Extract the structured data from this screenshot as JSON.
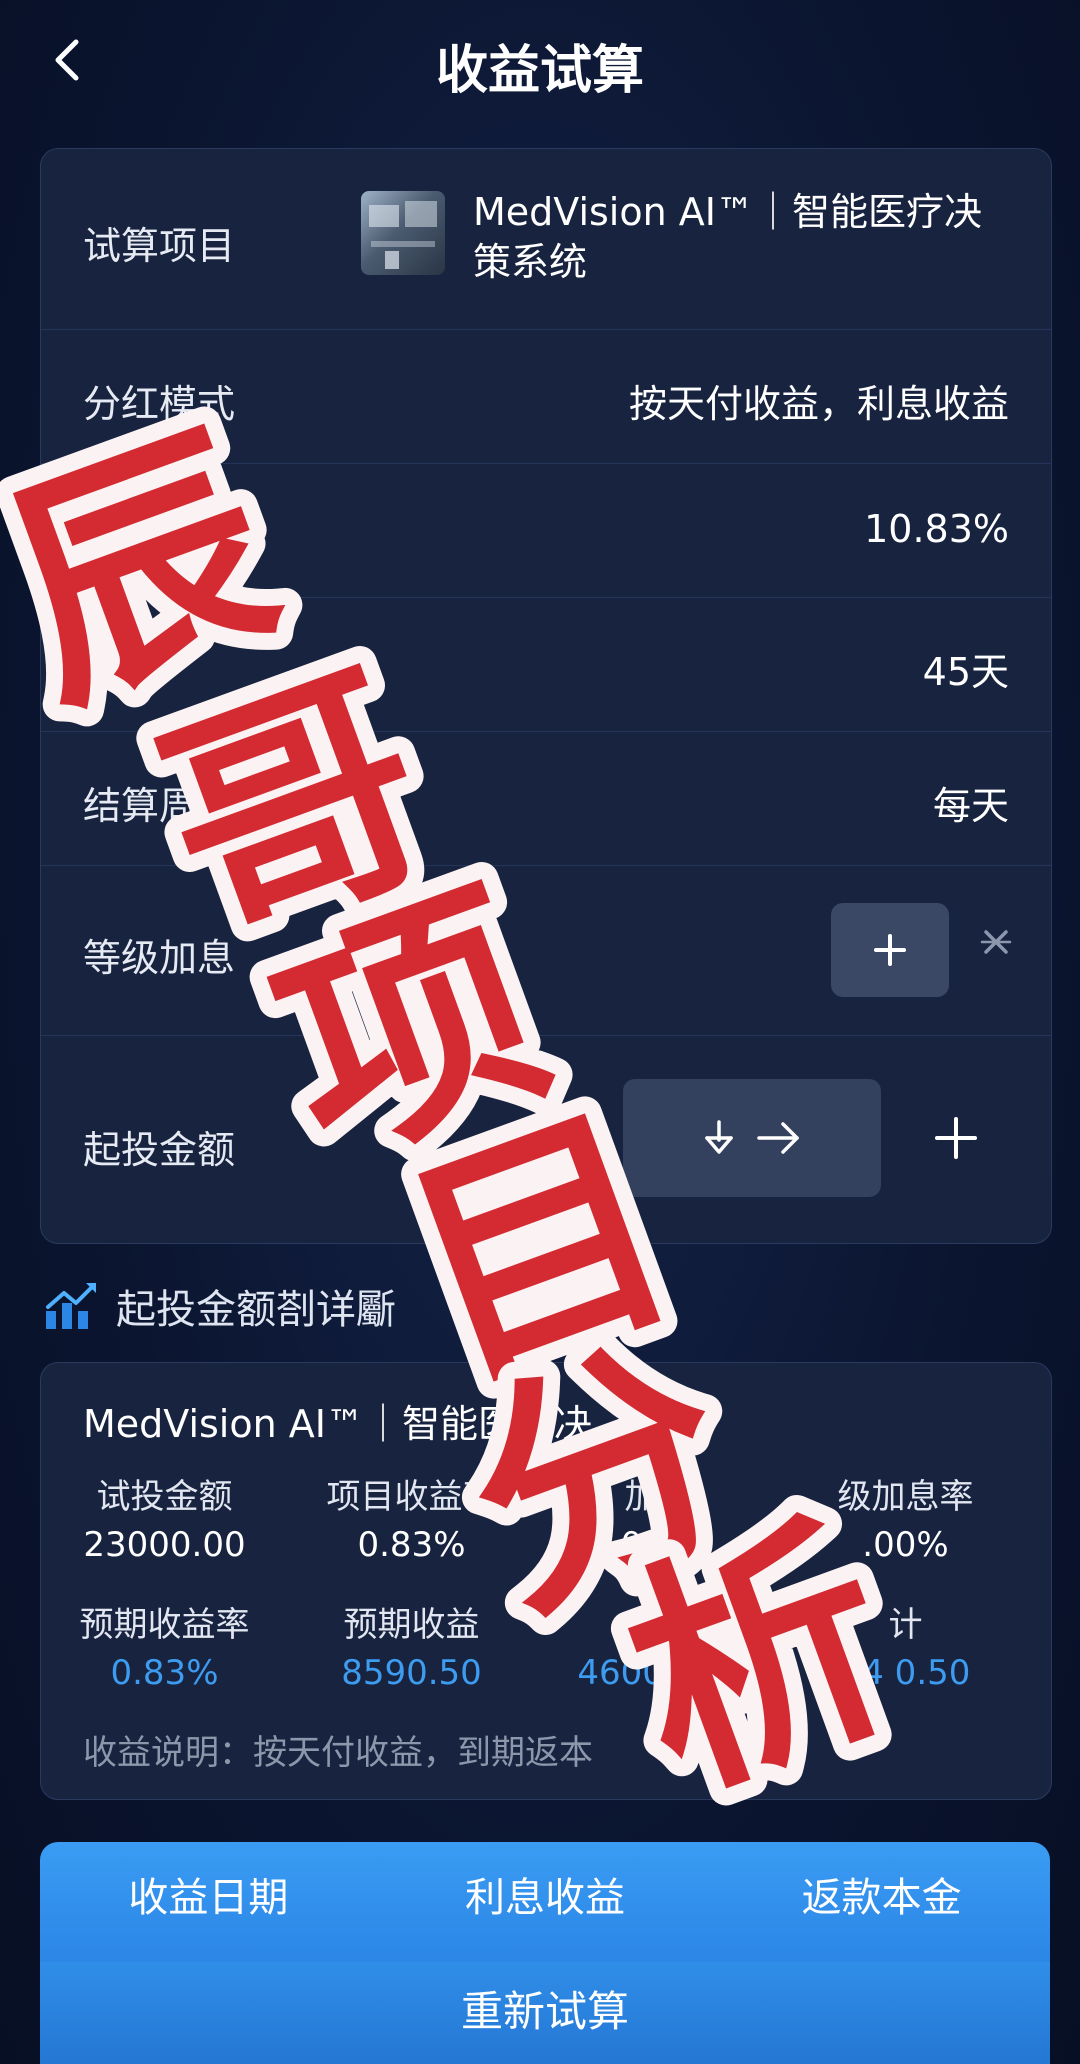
{
  "header": {
    "title": "收益试算"
  },
  "project": {
    "label": "试算项目",
    "name": "MedVision AI™｜智能医疗决策系统",
    "thumbnail_icon": "project-thumbnail"
  },
  "rows": {
    "dividend_mode": {
      "label": "分红模式",
      "value": "按天付收益，利息收益"
    },
    "rate": {
      "label": "项",
      "value": "10.83%"
    },
    "term": {
      "label": "项",
      "value": "45天"
    },
    "settle_cycle": {
      "label": "结算周",
      "value": "每天"
    },
    "level_bonus": {
      "label": "等级加息"
    },
    "min_invest": {
      "label": "起投金额"
    }
  },
  "detail_section": {
    "title": "起投金额剳详斸"
  },
  "detail_card": {
    "title": "MedVision AI™｜智能医疗决",
    "headers_row1": [
      "试投金额",
      "项目收益率",
      "加息",
      "级加息率"
    ],
    "values_row1": [
      "23000.00",
      "0.83%",
      "0.00",
      ".00%"
    ],
    "headers_row2": [
      "预期收益率",
      "预期收益",
      "应收",
      "计"
    ],
    "values_row2": [
      "0.83%",
      "8590.50",
      "46000.00",
      "54 0.50"
    ],
    "note": "收益说明：按天付收益，到期返本"
  },
  "bottom_tabs": [
    "收益日期",
    "利息收益",
    "返款本金"
  ],
  "recalc_button": "重新试算",
  "watermark": {
    "text": [
      "辰",
      "哥",
      "项",
      "目",
      "分",
      "析"
    ]
  },
  "colors": {
    "background": "#0b1530",
    "card": "#18233f",
    "accent_blue": "#2b86e6",
    "value_blue": "#3d9bf0",
    "watermark_red": "#d42a32"
  }
}
